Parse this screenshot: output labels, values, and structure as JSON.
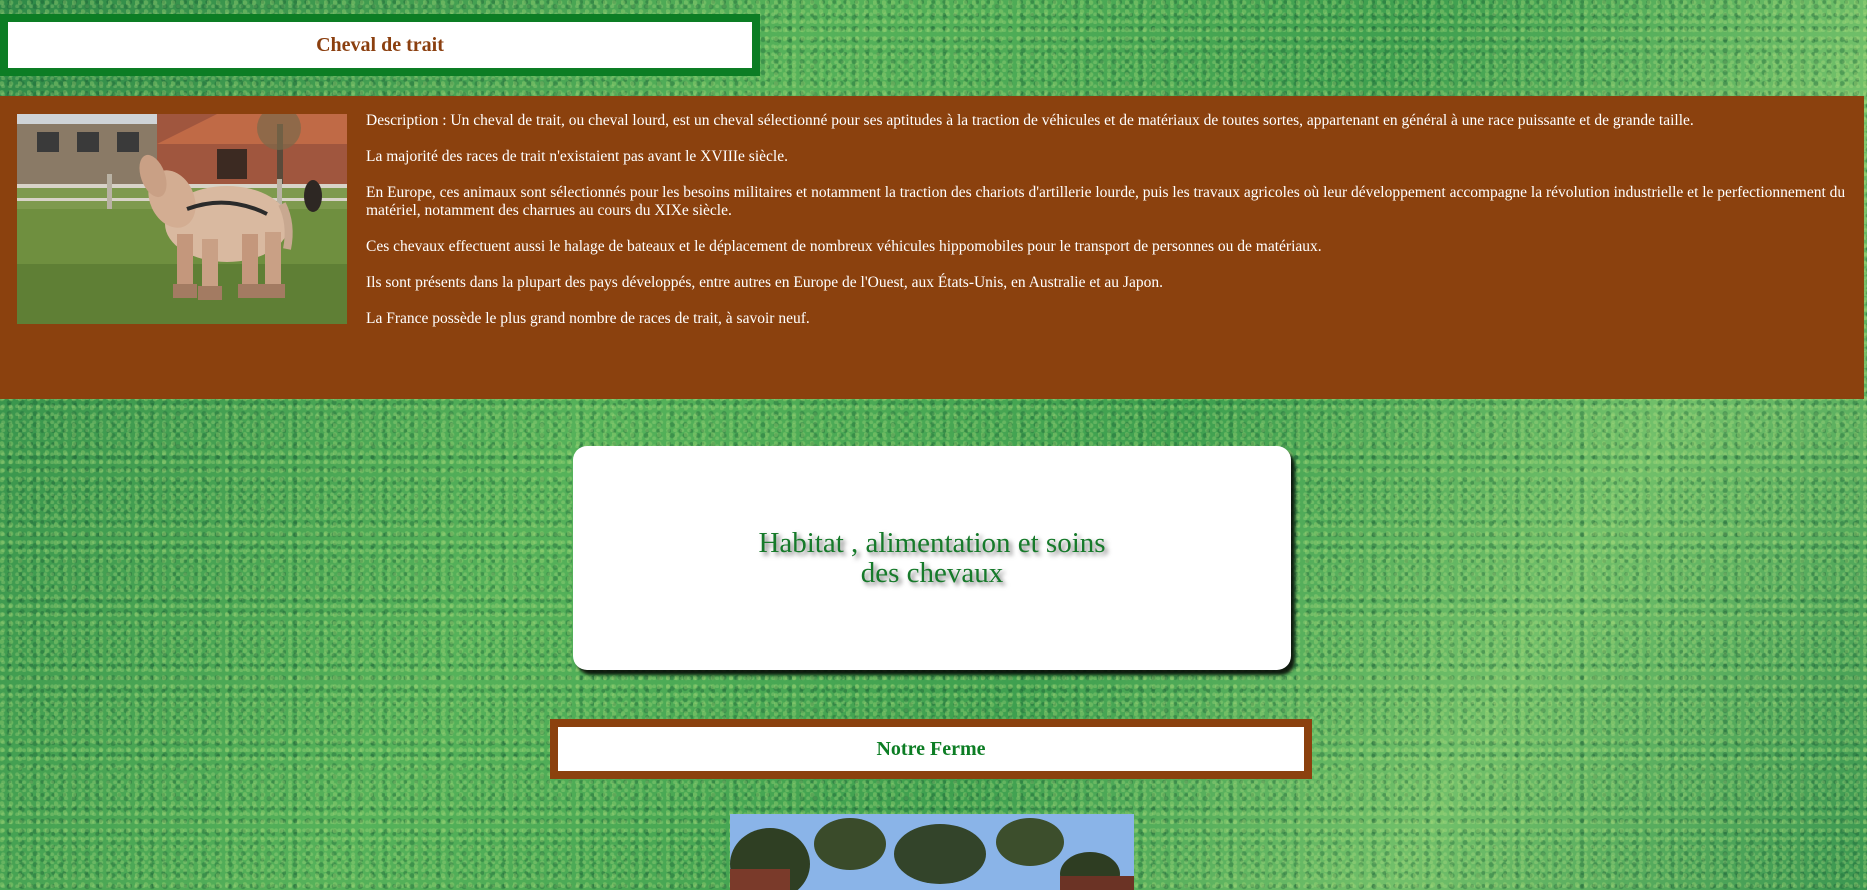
{
  "header": {
    "title": "Cheval de trait",
    "image_alt": "cheval de trait"
  },
  "description": {
    "paragraphs": [
      "Description : Un cheval de trait, ou cheval lourd, est un cheval sélectionné pour ses aptitudes à la traction de véhicules et de matériaux de toutes sortes, appartenant en général à une race puissante et de grande taille.",
      "La majorité des races de trait n'existaient pas avant le XVIIIe siècle.",
      "En Europe, ces animaux sont sélectionnés pour les besoins militaires et notamment la traction des chariots d'artillerie lourde, puis les travaux agricoles où leur développement accompagne la révolution industrielle et le perfectionnement du matériel, notamment des charrues au cours du XIXe siècle.",
      "Ces chevaux effectuent aussi le halage de bateaux et le déplacement de nombreux véhicules hippomobiles pour le transport de personnes ou de matériaux.",
      "Ils sont présents dans la plupart des pays développés, entre autres en Europe de l'Ouest, aux États-Unis, en Australie et au Japon.",
      "La France possède le plus grand nombre de races de trait, à savoir neuf."
    ]
  },
  "habitat": {
    "title": "Habitat , alimentation et soins des chevaux"
  },
  "farm": {
    "title": "Notre Ferme"
  },
  "colors": {
    "brown": "#8b410e",
    "green": "#0c7d24"
  }
}
